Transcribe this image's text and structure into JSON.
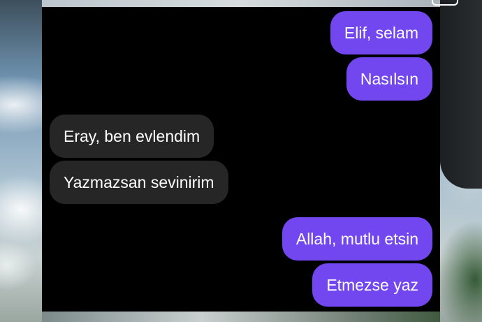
{
  "conversation": {
    "messages": [
      {
        "sender": "me",
        "text": "Elif, selam"
      },
      {
        "sender": "me",
        "text": "Nasılsın"
      },
      {
        "sender": "other",
        "text": "Eray, ben evlendim"
      },
      {
        "sender": "other",
        "text": "Yazmazsan sevinirim"
      },
      {
        "sender": "me",
        "text": "Allah, mutlu etsin"
      },
      {
        "sender": "me",
        "text": "Etmezse yaz"
      }
    ]
  },
  "colors": {
    "sent_bubble": "#7347f0",
    "received_bubble": "#262626",
    "chat_background": "#000000",
    "text": "#ffffff"
  },
  "icons": {
    "top_right": "rounded-rectangle-icon"
  }
}
